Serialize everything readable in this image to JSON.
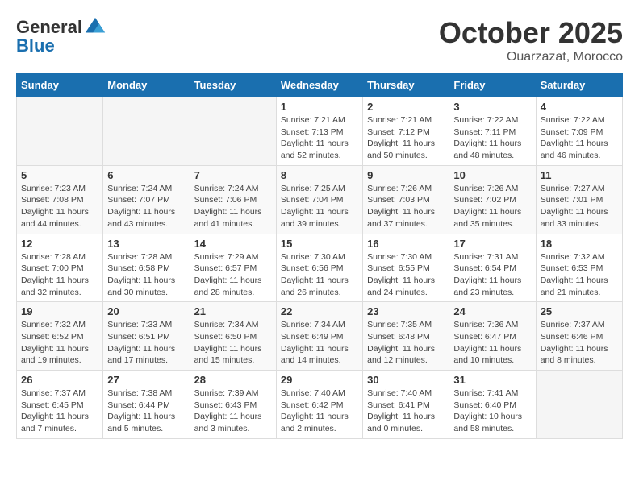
{
  "header": {
    "logo_line1": "General",
    "logo_line2": "Blue",
    "month": "October 2025",
    "location": "Ouarzazat, Morocco"
  },
  "days_of_week": [
    "Sunday",
    "Monday",
    "Tuesday",
    "Wednesday",
    "Thursday",
    "Friday",
    "Saturday"
  ],
  "weeks": [
    [
      {
        "day": "",
        "info": ""
      },
      {
        "day": "",
        "info": ""
      },
      {
        "day": "",
        "info": ""
      },
      {
        "day": "1",
        "info": "Sunrise: 7:21 AM\nSunset: 7:13 PM\nDaylight: 11 hours and 52 minutes."
      },
      {
        "day": "2",
        "info": "Sunrise: 7:21 AM\nSunset: 7:12 PM\nDaylight: 11 hours and 50 minutes."
      },
      {
        "day": "3",
        "info": "Sunrise: 7:22 AM\nSunset: 7:11 PM\nDaylight: 11 hours and 48 minutes."
      },
      {
        "day": "4",
        "info": "Sunrise: 7:22 AM\nSunset: 7:09 PM\nDaylight: 11 hours and 46 minutes."
      }
    ],
    [
      {
        "day": "5",
        "info": "Sunrise: 7:23 AM\nSunset: 7:08 PM\nDaylight: 11 hours and 44 minutes."
      },
      {
        "day": "6",
        "info": "Sunrise: 7:24 AM\nSunset: 7:07 PM\nDaylight: 11 hours and 43 minutes."
      },
      {
        "day": "7",
        "info": "Sunrise: 7:24 AM\nSunset: 7:06 PM\nDaylight: 11 hours and 41 minutes."
      },
      {
        "day": "8",
        "info": "Sunrise: 7:25 AM\nSunset: 7:04 PM\nDaylight: 11 hours and 39 minutes."
      },
      {
        "day": "9",
        "info": "Sunrise: 7:26 AM\nSunset: 7:03 PM\nDaylight: 11 hours and 37 minutes."
      },
      {
        "day": "10",
        "info": "Sunrise: 7:26 AM\nSunset: 7:02 PM\nDaylight: 11 hours and 35 minutes."
      },
      {
        "day": "11",
        "info": "Sunrise: 7:27 AM\nSunset: 7:01 PM\nDaylight: 11 hours and 33 minutes."
      }
    ],
    [
      {
        "day": "12",
        "info": "Sunrise: 7:28 AM\nSunset: 7:00 PM\nDaylight: 11 hours and 32 minutes."
      },
      {
        "day": "13",
        "info": "Sunrise: 7:28 AM\nSunset: 6:58 PM\nDaylight: 11 hours and 30 minutes."
      },
      {
        "day": "14",
        "info": "Sunrise: 7:29 AM\nSunset: 6:57 PM\nDaylight: 11 hours and 28 minutes."
      },
      {
        "day": "15",
        "info": "Sunrise: 7:30 AM\nSunset: 6:56 PM\nDaylight: 11 hours and 26 minutes."
      },
      {
        "day": "16",
        "info": "Sunrise: 7:30 AM\nSunset: 6:55 PM\nDaylight: 11 hours and 24 minutes."
      },
      {
        "day": "17",
        "info": "Sunrise: 7:31 AM\nSunset: 6:54 PM\nDaylight: 11 hours and 23 minutes."
      },
      {
        "day": "18",
        "info": "Sunrise: 7:32 AM\nSunset: 6:53 PM\nDaylight: 11 hours and 21 minutes."
      }
    ],
    [
      {
        "day": "19",
        "info": "Sunrise: 7:32 AM\nSunset: 6:52 PM\nDaylight: 11 hours and 19 minutes."
      },
      {
        "day": "20",
        "info": "Sunrise: 7:33 AM\nSunset: 6:51 PM\nDaylight: 11 hours and 17 minutes."
      },
      {
        "day": "21",
        "info": "Sunrise: 7:34 AM\nSunset: 6:50 PM\nDaylight: 11 hours and 15 minutes."
      },
      {
        "day": "22",
        "info": "Sunrise: 7:34 AM\nSunset: 6:49 PM\nDaylight: 11 hours and 14 minutes."
      },
      {
        "day": "23",
        "info": "Sunrise: 7:35 AM\nSunset: 6:48 PM\nDaylight: 11 hours and 12 minutes."
      },
      {
        "day": "24",
        "info": "Sunrise: 7:36 AM\nSunset: 6:47 PM\nDaylight: 11 hours and 10 minutes."
      },
      {
        "day": "25",
        "info": "Sunrise: 7:37 AM\nSunset: 6:46 PM\nDaylight: 11 hours and 8 minutes."
      }
    ],
    [
      {
        "day": "26",
        "info": "Sunrise: 7:37 AM\nSunset: 6:45 PM\nDaylight: 11 hours and 7 minutes."
      },
      {
        "day": "27",
        "info": "Sunrise: 7:38 AM\nSunset: 6:44 PM\nDaylight: 11 hours and 5 minutes."
      },
      {
        "day": "28",
        "info": "Sunrise: 7:39 AM\nSunset: 6:43 PM\nDaylight: 11 hours and 3 minutes."
      },
      {
        "day": "29",
        "info": "Sunrise: 7:40 AM\nSunset: 6:42 PM\nDaylight: 11 hours and 2 minutes."
      },
      {
        "day": "30",
        "info": "Sunrise: 7:40 AM\nSunset: 6:41 PM\nDaylight: 11 hours and 0 minutes."
      },
      {
        "day": "31",
        "info": "Sunrise: 7:41 AM\nSunset: 6:40 PM\nDaylight: 10 hours and 58 minutes."
      },
      {
        "day": "",
        "info": ""
      }
    ]
  ]
}
